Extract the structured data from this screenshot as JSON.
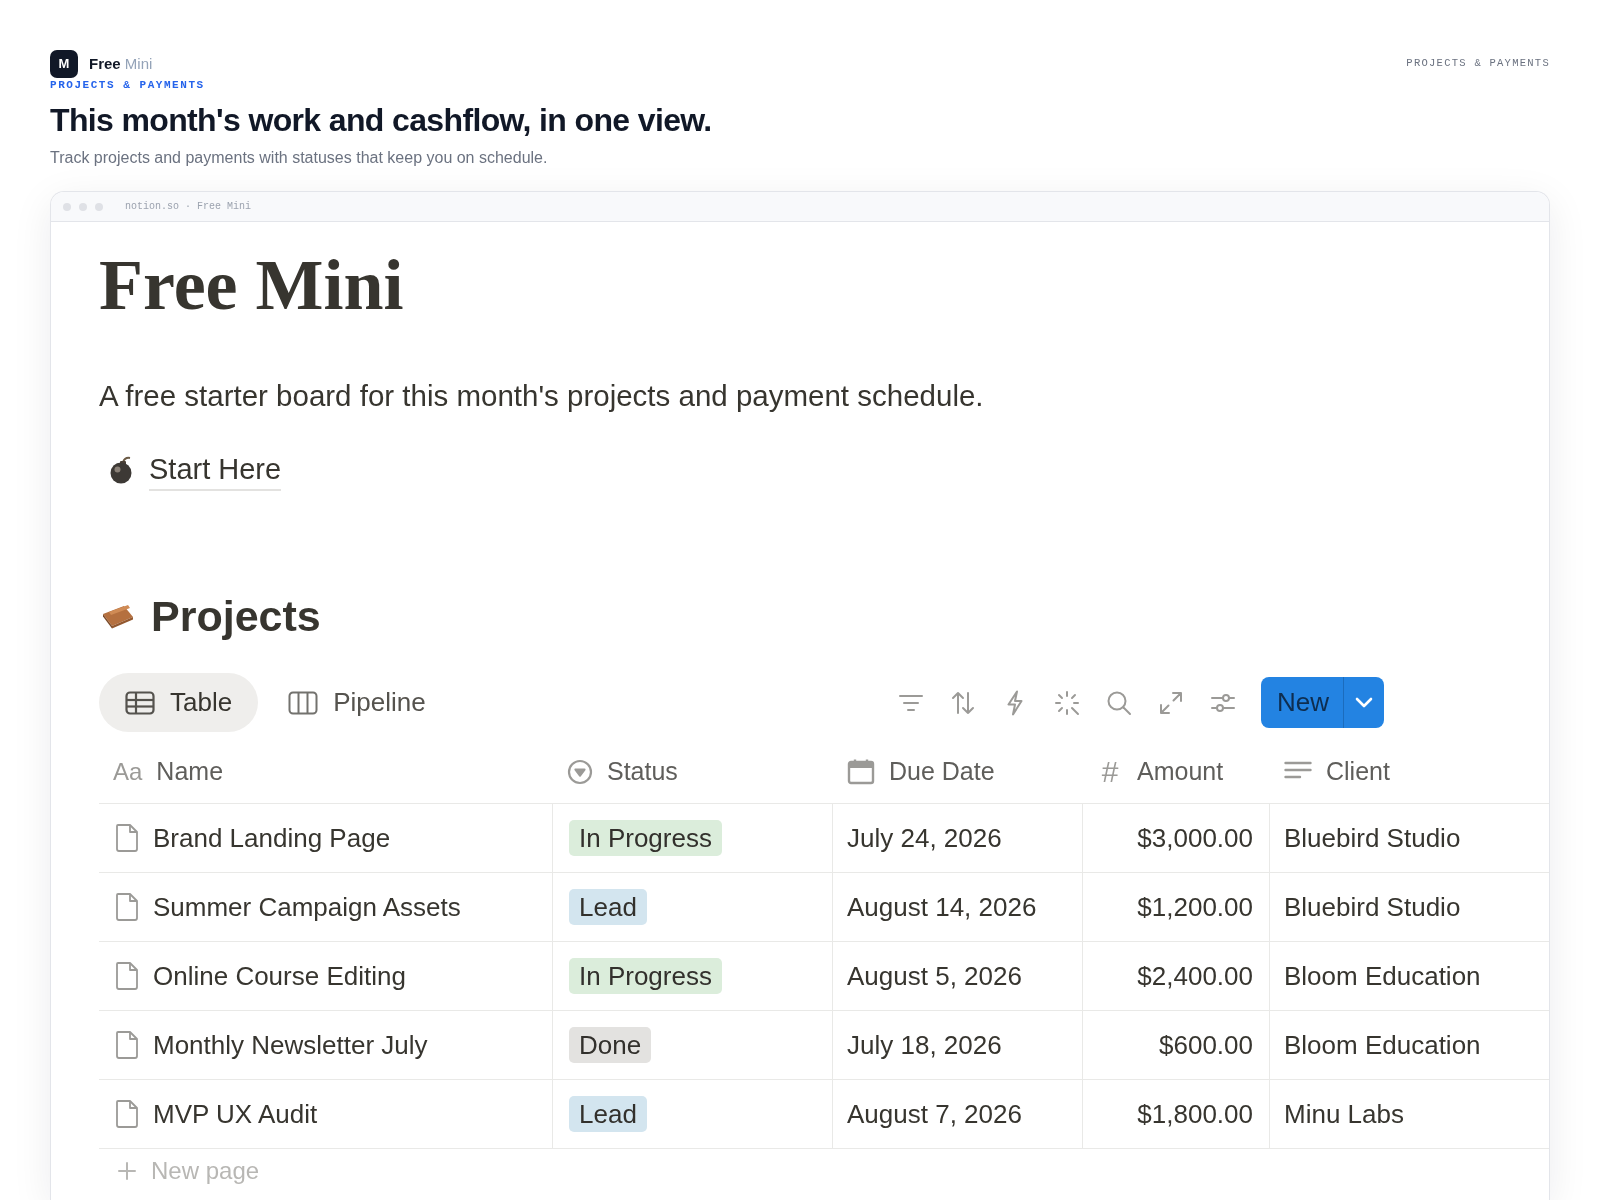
{
  "brand": {
    "logo_letter": "M",
    "name": "Free",
    "name_suffix": "Mini",
    "tagline": "PROJECTS & PAYMENTS"
  },
  "header_label": "PROJECTS & PAYMENTS",
  "hero": {
    "title": "This month's work and cashflow, in one view.",
    "subtitle": "Track projects and payments with statuses that keep you on schedule."
  },
  "browser": {
    "address": "notion.so · Free Mini"
  },
  "page": {
    "title": "Free Mini",
    "description": "A free starter board for this month's projects and payment schedule.",
    "link": {
      "label": "Start Here"
    }
  },
  "database": {
    "title": "Projects",
    "views": [
      {
        "label": "Table",
        "kind": "table",
        "selected": true
      },
      {
        "label": "Pipeline",
        "kind": "board",
        "selected": false
      }
    ],
    "new_button": {
      "label": "New"
    },
    "columns": [
      {
        "label": "Name",
        "kind": "title",
        "glyph": "Aa"
      },
      {
        "label": "Status",
        "kind": "status"
      },
      {
        "label": "Due Date",
        "kind": "date"
      },
      {
        "label": "Amount",
        "kind": "number",
        "glyph": "#"
      },
      {
        "label": "Client",
        "kind": "text"
      }
    ],
    "rows": [
      {
        "name": "Brand Landing Page",
        "status": {
          "label": "In Progress",
          "color": "#dbeddb"
        },
        "due_date": "July 24, 2026",
        "amount": "$3,000.00",
        "client": "Bluebird Studio"
      },
      {
        "name": "Summer Campaign Assets",
        "status": {
          "label": "Lead",
          "color": "#d3e5ef"
        },
        "due_date": "August 14, 2026",
        "amount": "$1,200.00",
        "client": "Bluebird Studio"
      },
      {
        "name": "Online Course Editing",
        "status": {
          "label": "In Progress",
          "color": "#dbeddb"
        },
        "due_date": "August 5, 2026",
        "amount": "$2,400.00",
        "client": "Bloom Education"
      },
      {
        "name": "Monthly Newsletter July",
        "status": {
          "label": "Done",
          "color": "#e3e2e0"
        },
        "due_date": "July 18, 2026",
        "amount": "$600.00",
        "client": "Bloom Education"
      },
      {
        "name": "MVP UX Audit",
        "status": {
          "label": "Lead",
          "color": "#d3e5ef"
        },
        "due_date": "August 7, 2026",
        "amount": "$1,800.00",
        "client": "Minu Labs"
      }
    ],
    "add_row": {
      "label": "New page"
    }
  }
}
